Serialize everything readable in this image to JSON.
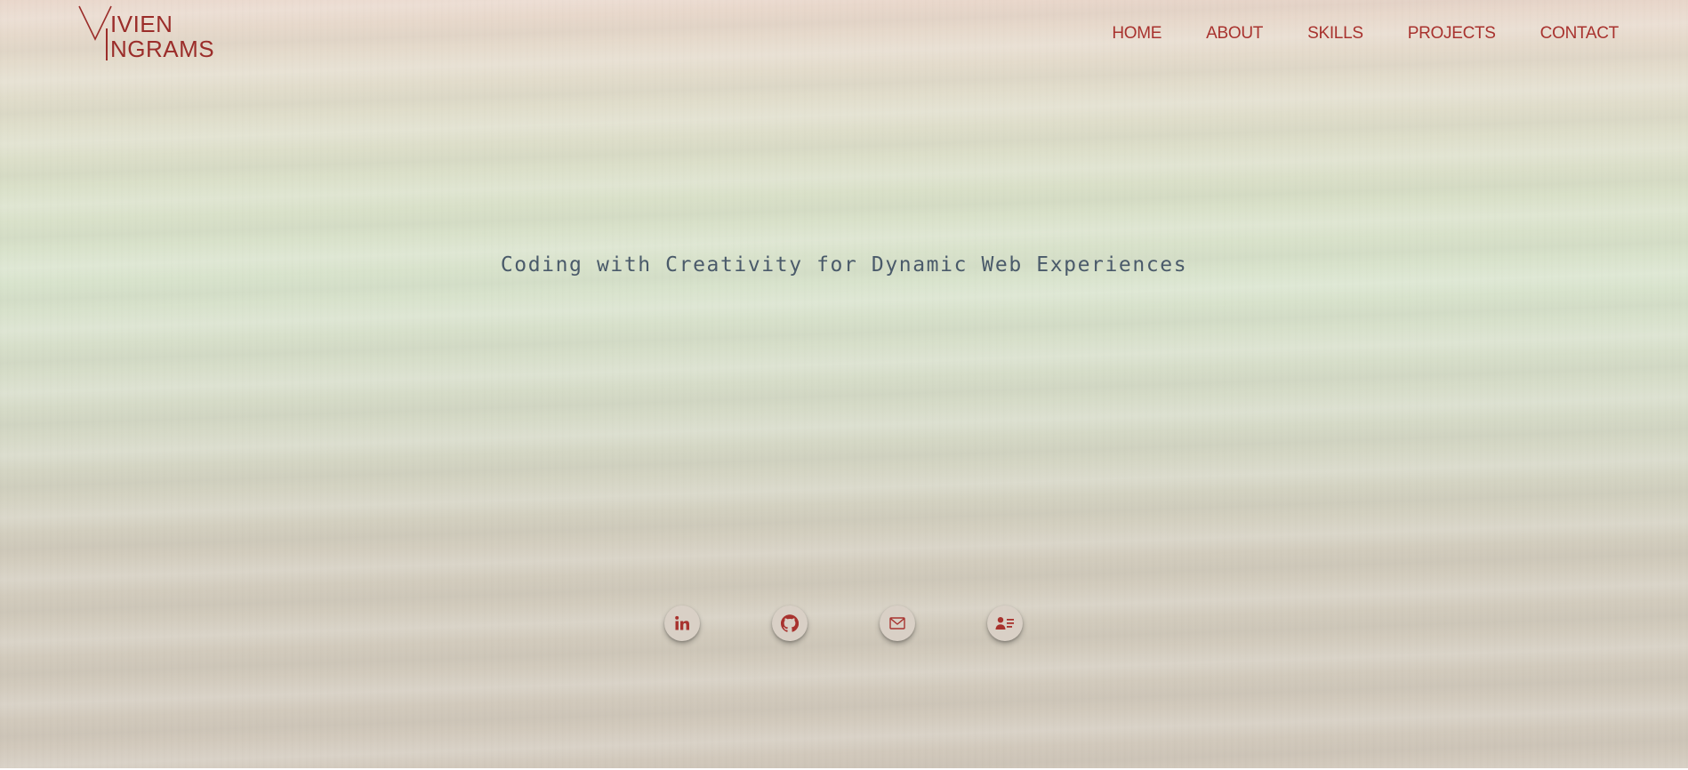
{
  "logo": {
    "first": "IVIEN",
    "second": "NGRAMS",
    "name": "Vivien Ingrams"
  },
  "nav": {
    "items": [
      {
        "label": "HOME"
      },
      {
        "label": "ABOUT"
      },
      {
        "label": "SKILLS"
      },
      {
        "label": "PROJECTS"
      },
      {
        "label": "CONTACT"
      }
    ]
  },
  "hero": {
    "tagline": "Coding with Creativity for Dynamic Web Experiences"
  },
  "socials": [
    {
      "icon": "linkedin-icon"
    },
    {
      "icon": "github-icon"
    },
    {
      "icon": "mail-icon"
    },
    {
      "icon": "contact-card-icon"
    }
  ],
  "colors": {
    "accent": "#a8322e",
    "tagline": "#4a5a6a",
    "button_bg": "#d9d0c6"
  }
}
